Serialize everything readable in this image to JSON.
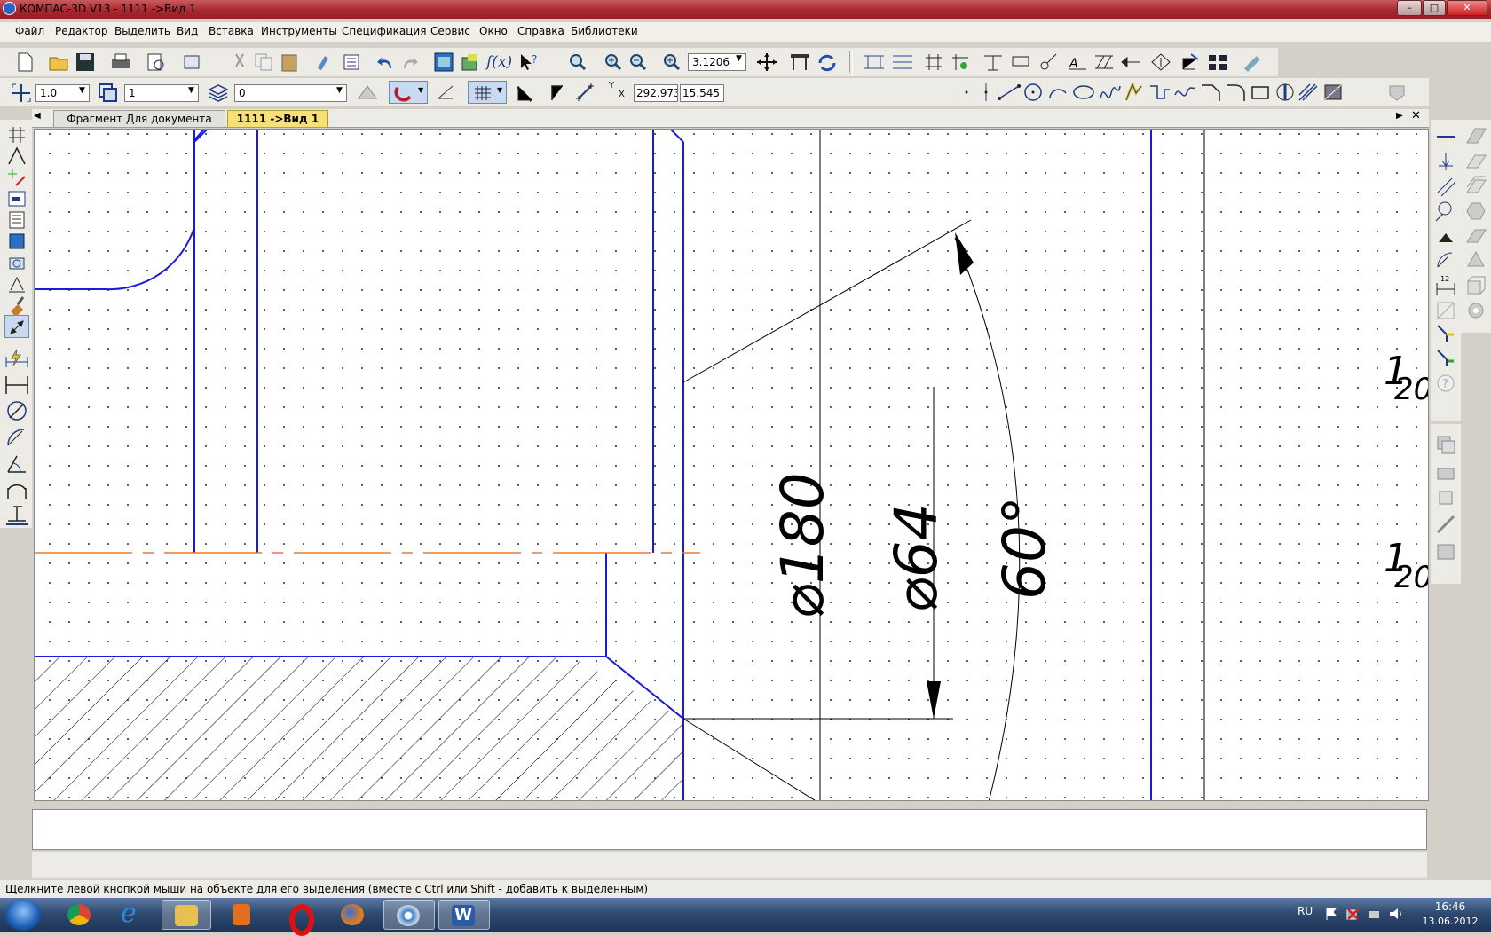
{
  "window": {
    "title": "КОМПАС-3D V13 - 1111 ->Вид 1",
    "minimize": "–",
    "maximize": "□",
    "close": "✕"
  },
  "menu": [
    "Файл",
    "Редактор",
    "Выделить",
    "Вид",
    "Вставка",
    "Инструменты",
    "Спецификация",
    "Сервис",
    "Окно",
    "Справка",
    "Библиотеки"
  ],
  "toolbar": {
    "zoom_value": "3.1206",
    "line_scale": "1.0",
    "layer_state": "1",
    "layer": "0",
    "coord_y_label": "Y",
    "coord_x_label": "X",
    "coord_x": "292.973",
    "coord_y": "15.545"
  },
  "tabs": [
    {
      "label": "Фрагмент Для документа",
      "active": false
    },
    {
      "label": "1111 ->Вид 1",
      "active": true
    }
  ],
  "drawing": {
    "dim1": "⌀180",
    "dim2": "⌀64",
    "dim3": "60°",
    "side1": "1",
    "side1b": "20",
    "side2": "1",
    "side2b": "20",
    "colors": {
      "outline": "#1a1adc",
      "axis": "#e87a2a",
      "thin": "#000000",
      "grid": "#2a2a2a"
    }
  },
  "status": {
    "hint": "Щелкните левой кнопкой мыши на объекте для его выделения (вместе с Ctrl или Shift - добавить к выделенным)"
  },
  "taskbar": {
    "lang": "RU",
    "time": "16:46",
    "date": "13.06.2012",
    "apps": [
      "start-orb",
      "chrome",
      "internet-explorer",
      "file-explorer",
      "media-player",
      "opera",
      "firefox",
      "kompas",
      "word"
    ]
  }
}
